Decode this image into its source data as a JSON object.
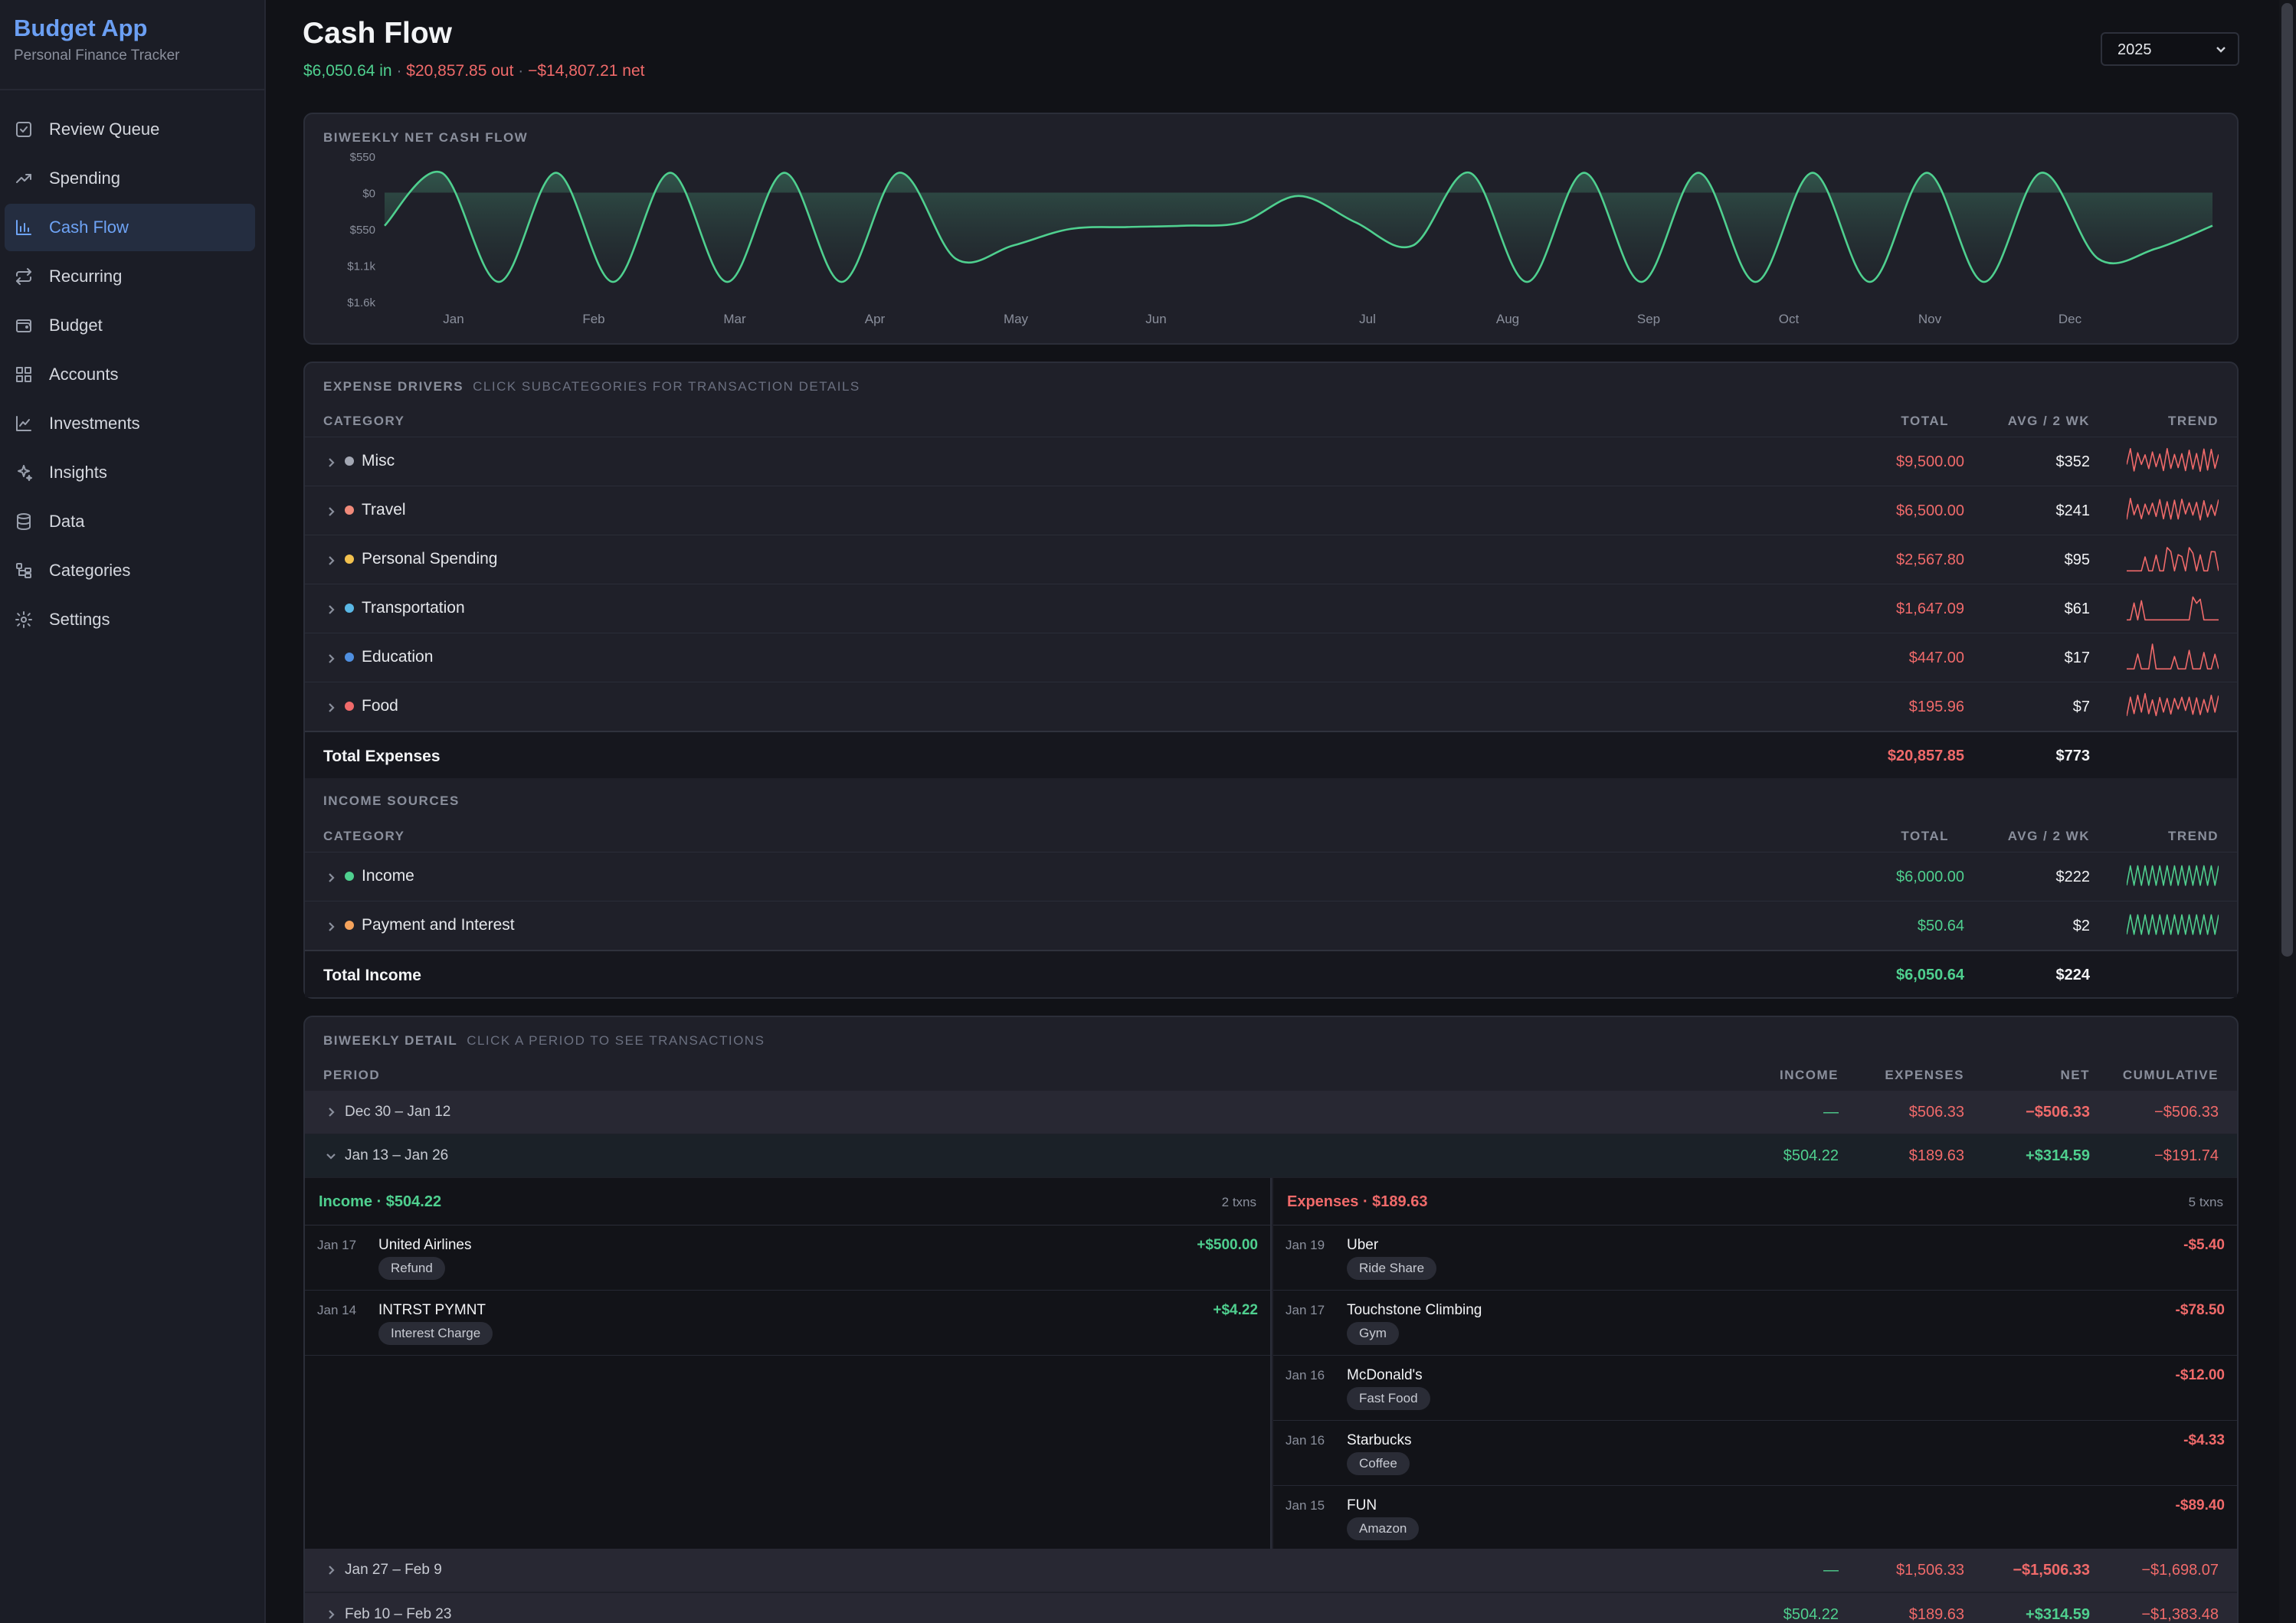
{
  "app": {
    "title": "Budget App",
    "subtitle": "Personal Finance Tracker"
  },
  "sidebar": {
    "items": [
      {
        "label": "Review Queue",
        "icon": "check-square-icon",
        "active": false
      },
      {
        "label": "Spending",
        "icon": "trending-up-icon",
        "active": false
      },
      {
        "label": "Cash Flow",
        "icon": "bar-chart-icon",
        "active": true
      },
      {
        "label": "Recurring",
        "icon": "repeat-icon",
        "active": false
      },
      {
        "label": "Budget",
        "icon": "wallet-icon",
        "active": false
      },
      {
        "label": "Accounts",
        "icon": "grid-icon",
        "active": false
      },
      {
        "label": "Investments",
        "icon": "line-chart-icon",
        "active": false
      },
      {
        "label": "Insights",
        "icon": "sparkles-icon",
        "active": false
      },
      {
        "label": "Data",
        "icon": "database-icon",
        "active": false
      },
      {
        "label": "Categories",
        "icon": "folder-tree-icon",
        "active": false
      },
      {
        "label": "Settings",
        "icon": "gear-icon",
        "active": false
      }
    ]
  },
  "header": {
    "title": "Cash Flow",
    "income": "$6,050.64 in",
    "sep1": " · ",
    "outflow": "$20,857.85 out",
    "sep2": " · ",
    "net": "−$14,807.21 net",
    "year": "2025"
  },
  "colors": {
    "green": "#4fd08f",
    "red": "#f06a6a",
    "accent": "#6b9ff3"
  },
  "chart": {
    "label": "BIWEEKLY NET CASH FLOW",
    "y_ticks": [
      "$550",
      "$0",
      "$550",
      "$1.1k",
      "$1.6k"
    ],
    "months": [
      "Jan",
      "Feb",
      "Mar",
      "Apr",
      "May",
      "Jun",
      "Jul",
      "Aug",
      "Sep",
      "Oct",
      "Nov",
      "Dec"
    ]
  },
  "chart_data": {
    "type": "area",
    "title": "BIWEEKLY NET CASH FLOW",
    "x": [
      "Jan",
      "Feb",
      "Mar",
      "Apr",
      "May",
      "Jun",
      "Jul",
      "Aug",
      "Sep",
      "Oct",
      "Nov",
      "Dec"
    ],
    "y_ticks": [
      "$550",
      "$0",
      "$550",
      "$1.1k",
      "$1.6k"
    ],
    "ylim": [
      -1650,
      550
    ],
    "series": [
      {
        "values": [
          -500,
          300,
          -1350,
          300,
          -1350,
          300,
          -1350,
          300,
          -1350,
          300,
          -1000,
          -800,
          -550,
          -520,
          -500,
          -450,
          -50,
          -450,
          -800,
          300,
          -1350,
          300,
          -1350,
          300,
          -1350,
          300,
          -1350,
          300,
          -1350,
          300,
          -1000,
          -850,
          -500
        ]
      }
    ],
    "grid": false,
    "legend": "none"
  },
  "drivers": {
    "label": "EXPENSE DRIVERS",
    "hint": "CLICK SUBCATEGORIES FOR TRANSACTION DETAILS",
    "headers": {
      "category": "CATEGORY",
      "total": "TOTAL",
      "avg": "AVG / 2 WK",
      "trend": "TREND"
    },
    "expenses": [
      {
        "name": "Misc",
        "color": "#a3a7b3",
        "total": "$9,500.00",
        "avg": "$352"
      },
      {
        "name": "Travel",
        "color": "#f08a7a",
        "total": "$6,500.00",
        "avg": "$241"
      },
      {
        "name": "Personal Spending",
        "color": "#f2c14e",
        "total": "$2,567.80",
        "avg": "$95"
      },
      {
        "name": "Transportation",
        "color": "#5ab8e6",
        "total": "$1,647.09",
        "avg": "$61"
      },
      {
        "name": "Education",
        "color": "#4f8fe0",
        "total": "$447.00",
        "avg": "$17"
      },
      {
        "name": "Food",
        "color": "#f06a6a",
        "total": "$195.96",
        "avg": "$7"
      }
    ],
    "total_expenses": {
      "label": "Total Expenses",
      "total": "$20,857.85",
      "avg": "$773"
    },
    "income_label": "INCOME SOURCES",
    "income": [
      {
        "name": "Income",
        "color": "#4fd08f",
        "total": "$6,000.00",
        "avg": "$222"
      },
      {
        "name": "Payment and Interest",
        "color": "#f5a35c",
        "total": "$50.64",
        "avg": "$2"
      }
    ],
    "total_income": {
      "label": "Total Income",
      "total": "$6,050.64",
      "avg": "$224"
    }
  },
  "detail": {
    "label": "BIWEEKLY DETAIL",
    "hint": "CLICK A PERIOD TO SEE TRANSACTIONS",
    "headers": {
      "period": "PERIOD",
      "income": "INCOME",
      "expenses": "EXPENSES",
      "net": "NET",
      "cumulative": "CUMULATIVE"
    },
    "periods": [
      {
        "label": "Dec 30 – Jan 12",
        "income": "—",
        "expenses": "$506.33",
        "net": "−$506.33",
        "cumulative": "−$506.33",
        "open": false
      },
      {
        "label": "Jan 13 – Jan 26",
        "income": "$504.22",
        "expenses": "$189.63",
        "net": "+$314.59",
        "cumulative": "−$191.74",
        "open": true
      },
      {
        "label": "Jan 27 – Feb 9",
        "income": "—",
        "expenses": "$1,506.33",
        "net": "−$1,506.33",
        "cumulative": "−$1,698.07",
        "open": false
      },
      {
        "label": "Feb 10 – Feb 23",
        "income": "$504.22",
        "expenses": "$189.63",
        "net": "+$314.59",
        "cumulative": "−$1,383.48",
        "open": false
      }
    ],
    "income_panel": {
      "title": "Income · $504.22",
      "count": "2 txns",
      "txns": [
        {
          "date": "Jan 17",
          "name": "United Airlines",
          "tag": "Refund",
          "amount": "+$500.00"
        },
        {
          "date": "Jan 14",
          "name": "INTRST PYMNT",
          "tag": "Interest Charge",
          "amount": "+$4.22"
        }
      ]
    },
    "expense_panel": {
      "title": "Expenses · $189.63",
      "count": "5 txns",
      "txns": [
        {
          "date": "Jan 19",
          "name": "Uber",
          "tag": "Ride Share",
          "amount": "-$5.40"
        },
        {
          "date": "Jan 17",
          "name": "Touchstone Climbing",
          "tag": "Gym",
          "amount": "-$78.50"
        },
        {
          "date": "Jan 16",
          "name": "McDonald's",
          "tag": "Fast Food",
          "amount": "-$12.00"
        },
        {
          "date": "Jan 16",
          "name": "Starbucks",
          "tag": "Coffee",
          "amount": "-$4.33"
        },
        {
          "date": "Jan 15",
          "name": "FUN",
          "tag": "Amazon",
          "amount": "-$89.40"
        }
      ]
    }
  }
}
